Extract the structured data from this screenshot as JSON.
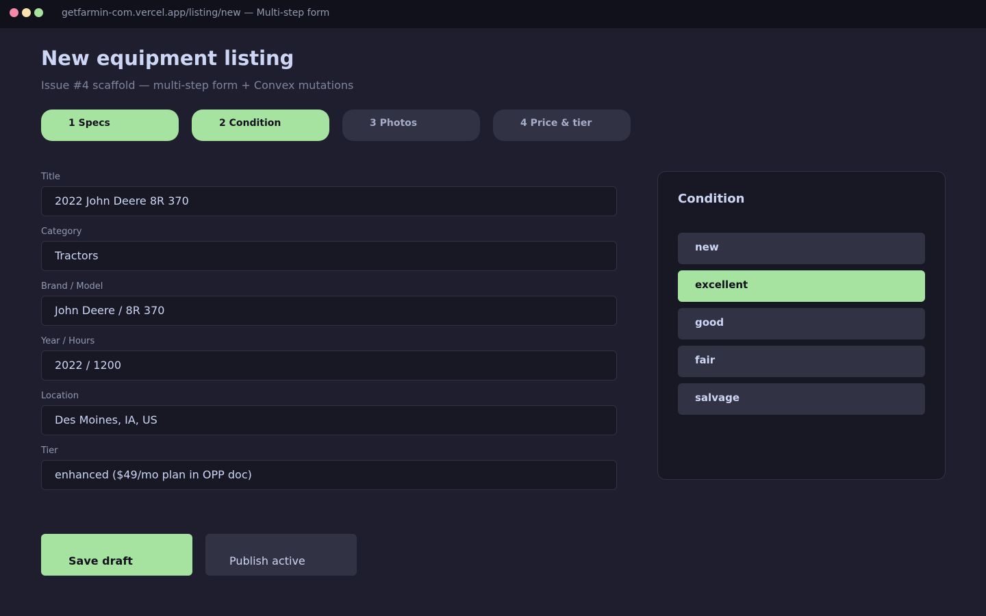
{
  "window": {
    "title": "getfarmin-com.vercel.app/listing/new — Multi-step form"
  },
  "header": {
    "title": "New equipment listing",
    "subtitle": "Issue #4 scaffold — multi-step form + Convex mutations"
  },
  "steps": [
    {
      "label": "1 Specs",
      "state": "done"
    },
    {
      "label": "2 Condition",
      "state": "active"
    },
    {
      "label": "3 Photos",
      "state": "pending"
    },
    {
      "label": "4 Price & tier",
      "state": "pending"
    }
  ],
  "form": {
    "fields": [
      {
        "label": "Title",
        "value": "2022 John Deere 8R 370"
      },
      {
        "label": "Category",
        "value": "Tractors"
      },
      {
        "label": "Brand / Model",
        "value": "John Deere  /  8R 370"
      },
      {
        "label": "Year / Hours",
        "value": "2022  /  1200"
      },
      {
        "label": "Location",
        "value": "Des Moines, IA, US"
      },
      {
        "label": "Tier",
        "value": "enhanced  ($49/mo plan in OPP doc)"
      }
    ]
  },
  "condition_panel": {
    "title": "Condition",
    "selected": "excellent",
    "options": [
      {
        "label": "new"
      },
      {
        "label": "excellent"
      },
      {
        "label": "good"
      },
      {
        "label": "fair"
      },
      {
        "label": "salvage"
      }
    ]
  },
  "actions": {
    "save_label": "Save draft",
    "publish_label": "Publish active"
  },
  "colors": {
    "background": "#1e1e2e",
    "accent": "#a6e3a1",
    "surface": "#313244",
    "field_bg": "#181825"
  }
}
